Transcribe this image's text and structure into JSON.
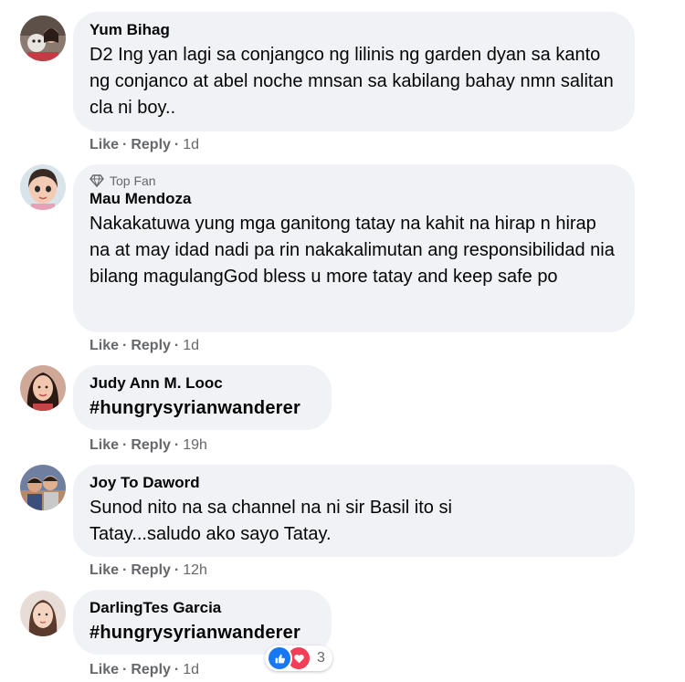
{
  "comments": [
    {
      "author": "Yum Bihag",
      "text": "D2 Ing yan lagi sa conjangco ng lilinis ng garden dyan sa kanto ng conjanco at abel noche mnsan sa kabilang bahay nmn salitan cla ni boy..",
      "like": "Like",
      "reply": "Reply",
      "time": "1d"
    },
    {
      "badge": "Top Fan",
      "author": "Mau Mendoza",
      "text": "Nakakatuwa yung mga ganitong tatay na kahit na hirap n hirap na at may idad nadi pa rin nakakalimutan ang responsibilidad nia bilang magulangGod bless u more tatay and keep safe po",
      "like": "Like",
      "reply": "Reply",
      "time": "1d"
    },
    {
      "author": "Judy Ann M. Looc",
      "text": "#hungrysyrianwanderer",
      "like": "Like",
      "reply": "Reply",
      "time": "19h"
    },
    {
      "author": "Joy To Daword",
      "text": "Sunod nito na sa channel na ni sir Basil ito si Tatay...saludo ako sayo Tatay.",
      "like": "Like",
      "reply": "Reply",
      "time": "12h"
    },
    {
      "author": "DarlingTes Garcia",
      "text": "#hungrysyrianwanderer",
      "like": "Like",
      "reply": "Reply",
      "time": "1d",
      "reactions": {
        "icons": [
          "like-icon",
          "love-icon"
        ],
        "count": "3"
      }
    }
  ],
  "separator": "·",
  "colors": {
    "bubble": "#f0f2f5",
    "meta": "#65676b",
    "like": "#1877f2",
    "love": "#f33e58"
  }
}
